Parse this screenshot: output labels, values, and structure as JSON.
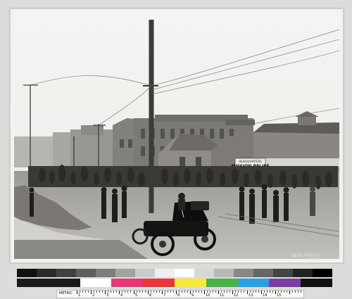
{
  "photograph": {
    "sign_line_1": "HEADQUARTERS",
    "sign_line_2": "MISSION RELIEF",
    "credit_line_1": "BEAR PHOTO",
    "credit_line_2": "1906"
  },
  "color_target": {
    "gray_patches": [
      "#111111",
      "#2a2a2a",
      "#414141",
      "#5f5f5f",
      "#7d7d7d",
      "#a2a2a2",
      "#cbcbcb",
      "#efefef",
      "#ffffff",
      "#d7d7d7",
      "#b8b8b8",
      "#888888",
      "#666666",
      "#444444",
      "#222222",
      "#000000"
    ],
    "color_patches": [
      "#1a1a1a",
      "#1a1a1a",
      "#ffffff",
      "#e13a78",
      "#e13a3a",
      "#f4e842",
      "#4bb04a",
      "#2d9fe2",
      "#7b3fa0",
      "#111111"
    ],
    "ruler_label": "METRIC",
    "ruler_numbers": [
      "1",
      "2",
      "3",
      "4",
      "5",
      "6",
      "7",
      "8",
      "9",
      "10",
      "11",
      "12",
      "13",
      "14",
      "15"
    ]
  }
}
